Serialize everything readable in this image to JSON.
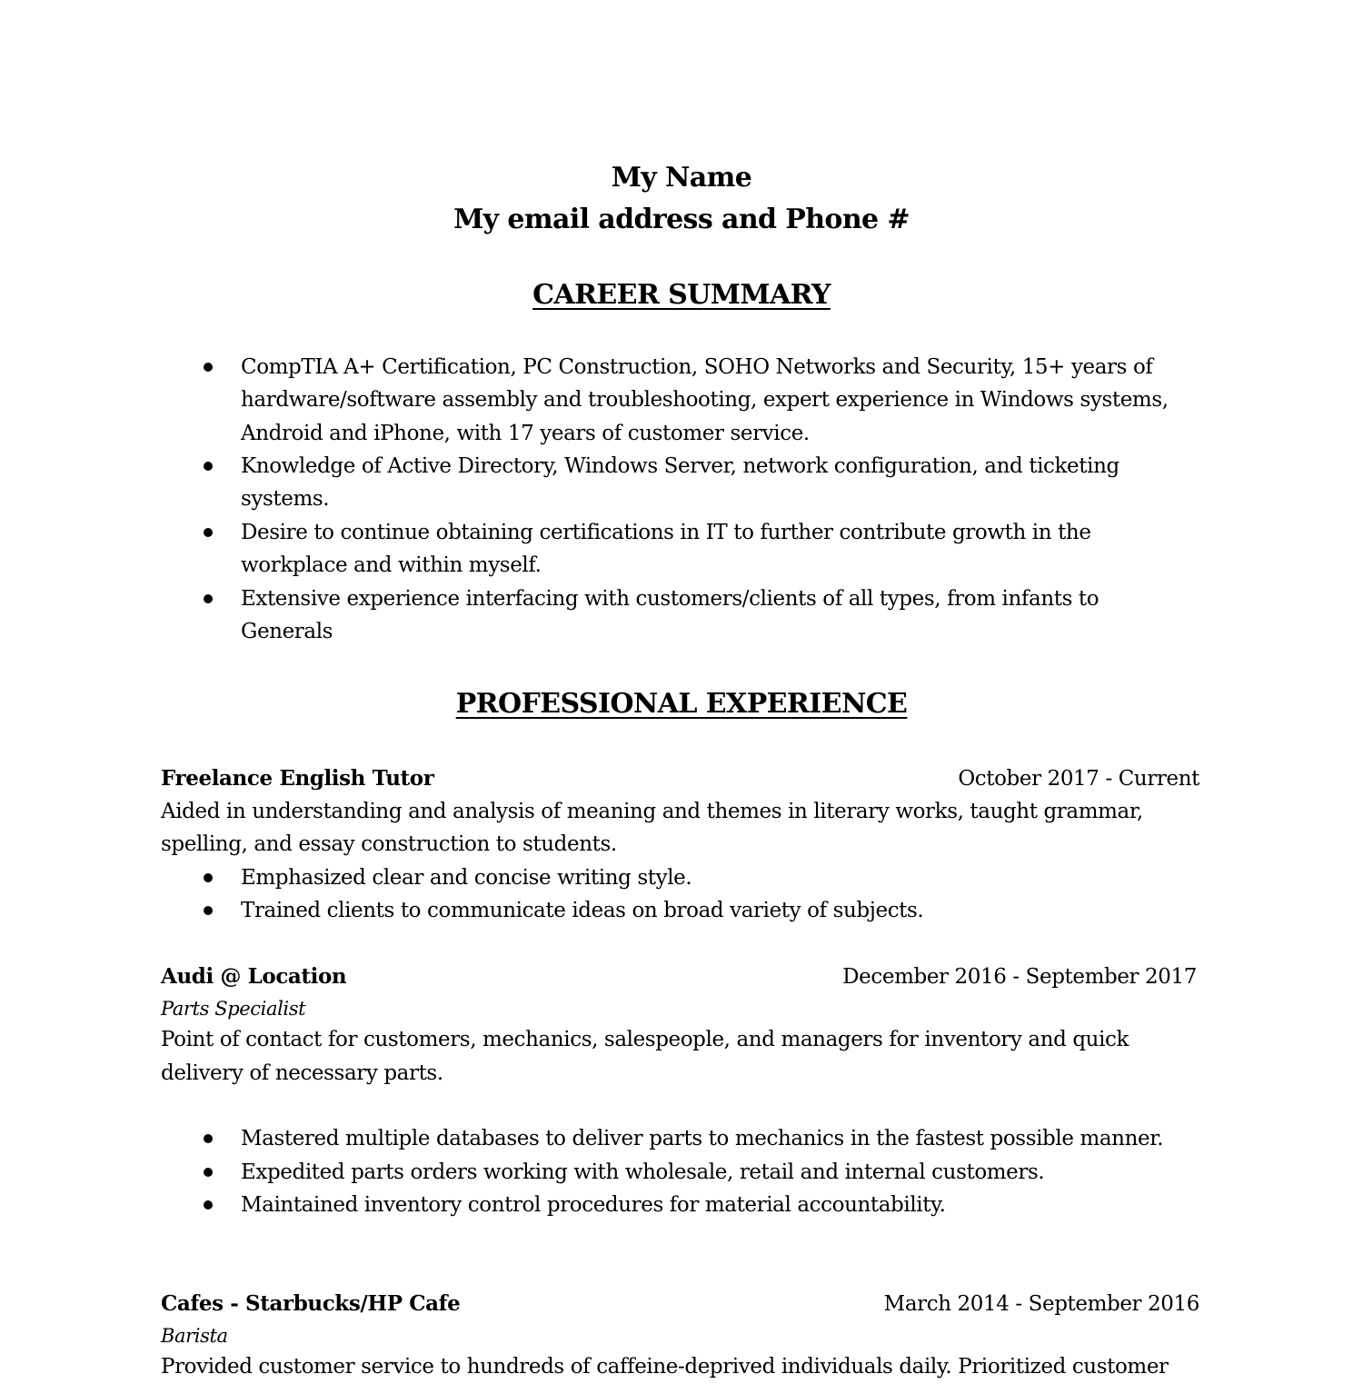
{
  "header": {
    "name": "My Name",
    "contact": "My email address and Phone #"
  },
  "career_summary": {
    "heading": "CAREER SUMMARY",
    "bullets": [
      {
        "lines": [
          "CompTIA A+ Certification, PC Construction, SOHO Networks and Security, 15+ years of",
          "hardware/software assembly and troubleshooting, expert experience in Windows systems,",
          "Android and iPhone, with 17 years of customer service."
        ]
      },
      {
        "lines": [
          "Knowledge of Active Directory, Windows Server, network configuration, and ticketing",
          "systems."
        ]
      },
      {
        "lines": [
          "Desire to continue obtaining certifications in IT to further contribute growth in the",
          "workplace and within myself."
        ]
      },
      {
        "lines": [
          "Extensive experience interfacing with customers/clients of all types, from infants to",
          "Generals"
        ]
      }
    ]
  },
  "professional_experience": {
    "heading": "PROFESSIONAL EXPERIENCE",
    "jobs": [
      {
        "employer": "Freelance English Tutor",
        "dates": "October 2017 - Current",
        "description": [
          "Aided in understanding and analysis of meaning and themes in literary works, taught grammar,",
          "spelling, and essay construction to students."
        ],
        "bullets": [
          "Emphasized clear and concise writing style.",
          "Trained clients to communicate ideas on broad variety of subjects."
        ]
      },
      {
        "employer": "Audi @ Location",
        "dates": "December 2016 - September 2017",
        "title": "Parts Specialist",
        "description": [
          "Point of contact for customers, mechanics, salespeople, and managers for inventory and quick",
          "delivery of necessary parts."
        ],
        "bullets": [
          "Mastered multiple databases to deliver parts to mechanics in the fastest possible manner.",
          "Expedited parts orders working with wholesale, retail and internal customers.",
          "Maintained inventory control procedures for material accountability."
        ]
      },
      {
        "employer": "Cafes - Starbucks/HP Cafe",
        "dates": "March 2014 - September 2016",
        "title": "Barista",
        "description": [
          "Provided customer service to hundreds of caffeine-deprived individuals daily. Prioritized customer"
        ]
      }
    ]
  }
}
